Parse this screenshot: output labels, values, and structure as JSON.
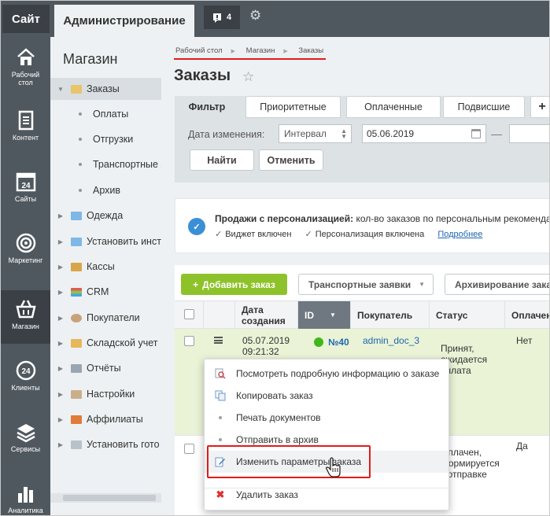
{
  "topbar": {
    "site_label": "Сайт",
    "admin_label": "Администрирование",
    "notifications_count": "4"
  },
  "leftnav": [
    {
      "label_line1": "Рабочий",
      "label_line2": "стол",
      "icon": "home-icon"
    },
    {
      "label_line1": "Контент",
      "label_line2": "",
      "icon": "document-icon"
    },
    {
      "label_line1": "Сайты",
      "label_line2": "",
      "icon": "calendar-icon"
    },
    {
      "label_line1": "Маркетинг",
      "label_line2": "",
      "icon": "target-icon"
    },
    {
      "label_line1": "Магазин",
      "label_line2": "",
      "icon": "basket-icon"
    },
    {
      "label_line1": "Клиенты",
      "label_line2": "",
      "icon": "clients-icon"
    },
    {
      "label_line1": "Сервисы",
      "label_line2": "",
      "icon": "layers-icon"
    },
    {
      "label_line1": "Аналитика",
      "label_line2": "",
      "icon": "analytics-icon"
    }
  ],
  "sidebar": {
    "title": "Магазин",
    "items": [
      {
        "label": "Заказы"
      },
      {
        "label": "Оплаты"
      },
      {
        "label": "Отгрузки"
      },
      {
        "label": "Транспортные з"
      },
      {
        "label": "Архив"
      },
      {
        "label": "Одежда"
      },
      {
        "label": "Установить инст"
      },
      {
        "label": "Кассы"
      },
      {
        "label": "CRM"
      },
      {
        "label": "Покупатели"
      },
      {
        "label": "Складской учет"
      },
      {
        "label": "Отчёты"
      },
      {
        "label": "Настройки"
      },
      {
        "label": "Аффилиаты"
      },
      {
        "label": "Установить гото"
      }
    ]
  },
  "breadcrumb": [
    "Рабочий стол",
    "Магазин",
    "Заказы"
  ],
  "page": {
    "title": "Заказы"
  },
  "filter": {
    "tabs": [
      "Фильтр",
      "Приоритетные",
      "Оплаченные",
      "Подвисшие",
      "+"
    ],
    "date_label": "Дата изменения:",
    "interval_value": "Интервал",
    "date_from": "05.06.2019",
    "date_dash": "—",
    "find_label": "Найти",
    "cancel_label": "Отменить"
  },
  "notice": {
    "icon_text": "✓",
    "title": "Продажи с персонализацией:",
    "text": " кол-во заказов по персональным рекомендациям",
    "widget": "Виджет включен",
    "personalization": "Персонализация включена",
    "more": "Подробнее"
  },
  "grid": {
    "add_label": "Добавить заказ",
    "transport_label": "Транспортные заявки",
    "archive_label": "Архивирование заказов",
    "columns": {
      "date_line1": "Дата",
      "date_line2": "создания",
      "id": "ID",
      "buyer": "Покупатель",
      "status": "Статус",
      "paid": "Оплачен"
    },
    "row1": {
      "date_line1": "05.07.2019",
      "date_line2": "09:21:32",
      "id": "№40",
      "buyer": "admin_doc_3",
      "status_line1": "Принят,",
      "status_line2": "ожидается",
      "status_line3": "оплата",
      "paid": "Нет"
    },
    "row2": {
      "status_line1": "Оплачен,",
      "status_line2": "формируется",
      "status_line3": "к отправке",
      "paid": "Да"
    }
  },
  "context_menu": {
    "items": [
      {
        "label": "Посмотреть подробную информацию о заказе",
        "icon": "view-icon"
      },
      {
        "label": "Копировать заказ",
        "icon": "copy-icon"
      },
      {
        "label": "Печать документов",
        "icon": "bullet-icon"
      },
      {
        "label": "Отправить в архив",
        "icon": "bullet-icon"
      },
      {
        "label": "Изменить параметры заказа",
        "icon": "edit-icon"
      },
      {
        "label": "Удалить заказ",
        "icon": "delete-icon"
      }
    ]
  },
  "colors": {
    "accent_red": "#e21b1b",
    "add_green": "#8ec22a",
    "topbar": "#50585f",
    "row_highlight": "#eaf3d6"
  }
}
